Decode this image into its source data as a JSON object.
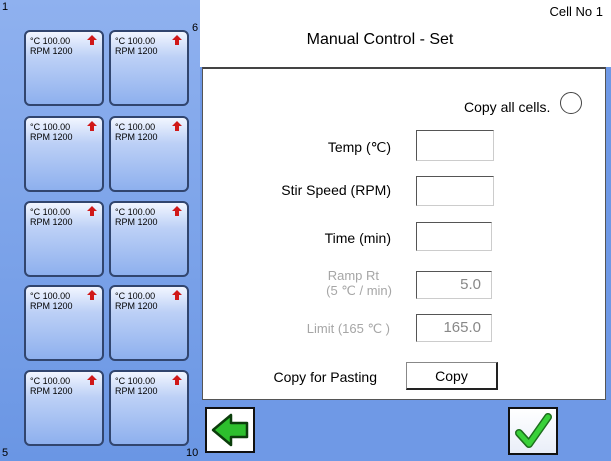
{
  "header": {
    "title": "Manual Control - Set",
    "cell_no": "Cell No  1"
  },
  "grid": {
    "corner_tl": "1",
    "corner_tr": "6",
    "corner_bl": "5",
    "corner_br": "10",
    "cells": [
      {
        "temp": "°C 100.00",
        "rpm": "RPM 1200"
      },
      {
        "temp": "°C 100.00",
        "rpm": "RPM 1200"
      },
      {
        "temp": "°C 100.00",
        "rpm": "RPM 1200"
      },
      {
        "temp": "°C 100.00",
        "rpm": "RPM 1200"
      },
      {
        "temp": "°C 100.00",
        "rpm": "RPM 1200"
      },
      {
        "temp": "°C 100.00",
        "rpm": "RPM 1200"
      },
      {
        "temp": "°C 100.00",
        "rpm": "RPM 1200"
      },
      {
        "temp": "°C 100.00",
        "rpm": "RPM 1200"
      },
      {
        "temp": "°C 100.00",
        "rpm": "RPM 1200"
      },
      {
        "temp": "°C 100.00",
        "rpm": "RPM 1200"
      }
    ]
  },
  "form": {
    "copy_all_label": "Copy all cells.",
    "temp_label": "Temp (℃)",
    "temp_value": "",
    "stir_label": "Stir Speed (RPM)",
    "stir_value": "",
    "time_label": "Time (min)",
    "time_value": "",
    "ramp_label_1": "Ramp Rt",
    "ramp_label_2": "(5 ℃ / min)",
    "ramp_value": "5.0",
    "limit_label": "Limit (165 ℃ )",
    "limit_value": "165.0",
    "copy_pasting_label": "Copy for Pasting",
    "copy_button": "Copy"
  },
  "icons": {
    "back": "back-arrow-icon",
    "confirm": "checkmark-icon",
    "cell_up": "up-arrow-icon"
  },
  "colors": {
    "background": "#6f99e6",
    "arrow_green": "#2dbf2d",
    "cell_arrow_red": "#d01818"
  }
}
